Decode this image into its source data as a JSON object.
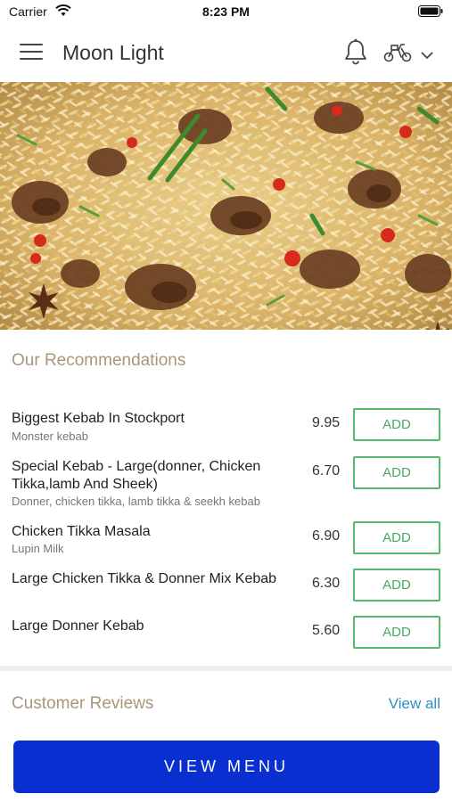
{
  "status_bar": {
    "carrier": "Carrier",
    "time": "8:23 PM",
    "wifi_icon": "wifi-icon",
    "battery_icon": "battery-icon"
  },
  "header": {
    "title": "Moon Light",
    "menu_icon": "hamburger-menu-icon",
    "notification_icon": "bell-icon",
    "delivery_icon": "scooter-icon",
    "dropdown_icon": "chevron-down-icon"
  },
  "hero": {
    "image": "biryani-dish-photo"
  },
  "recommendations": {
    "title": "Our Recommendations",
    "items": [
      {
        "name": "Biggest Kebab In Stockport",
        "description": "Monster kebab",
        "price": "9.95",
        "button": "ADD"
      },
      {
        "name": "Special Kebab - Large(donner, Chicken Tikka,lamb And Sheek)",
        "description": "Donner, chicken tikka, lamb tikka & seekh kebab",
        "price": "6.70",
        "button": "ADD"
      },
      {
        "name": "Chicken Tikka Masala",
        "description": "Lupin  Milk",
        "price": "6.90",
        "button": "ADD"
      },
      {
        "name": "Large Chicken Tikka & Donner Mix Kebab",
        "description": "",
        "price": "6.30",
        "button": "ADD"
      },
      {
        "name": "Large Donner Kebab",
        "description": "",
        "price": "5.60",
        "button": "ADD"
      }
    ]
  },
  "reviews": {
    "title": "Customer Reviews",
    "view_all": "View all"
  },
  "footer": {
    "view_menu": "VIEW MENU"
  },
  "colors": {
    "accent_blue": "#0a2fd0",
    "add_green": "#54b96f",
    "section_title": "#a8977a",
    "link_blue": "#2c8fc0"
  }
}
